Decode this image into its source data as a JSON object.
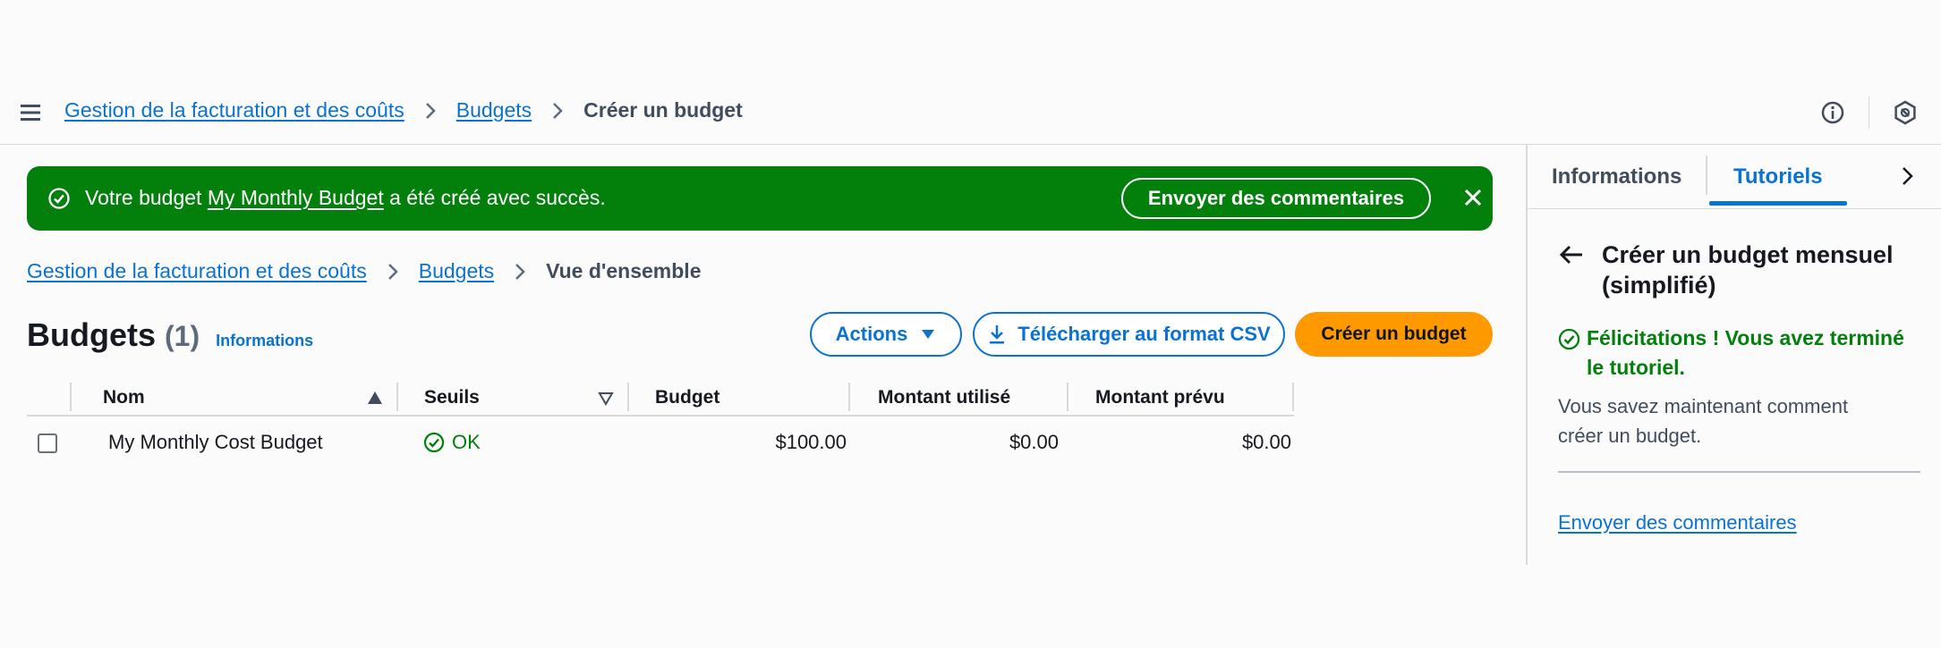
{
  "topbar": {
    "breadcrumb": {
      "root": "Gestion de la facturation et des coûts",
      "budgets": "Budgets",
      "current": "Créer un budget"
    },
    "icons": [
      "menu-icon",
      "info-icon",
      "notifications-icon"
    ]
  },
  "flash": {
    "prefix": "Votre budget ",
    "budget_name": "My Monthly Budget",
    "suffix": " a été créé avec succès.",
    "feedback_button": "Envoyer des commentaires",
    "color": "#037f0c"
  },
  "page": {
    "breadcrumb": {
      "root": "Gestion de la facturation et des coûts",
      "budgets": "Budgets",
      "current": "Vue d'ensemble"
    },
    "title": "Budgets",
    "count": "(1)",
    "info_link": "Informations",
    "actions_button": "Actions",
    "csv_button": "Télécharger au format CSV",
    "create_button": "Créer un budget",
    "accent_color": "#0972d3",
    "primary_color": "#ff9900"
  },
  "table": {
    "columns": [
      "Nom",
      "Seuils",
      "Budget",
      "Montant utilisé",
      "Montant prévu"
    ],
    "rows": [
      {
        "name": "My Monthly Cost Budget",
        "threshold": "OK",
        "budget": "$100.00",
        "used": "$0.00",
        "forecast": "$0.00"
      }
    ]
  },
  "side_panel": {
    "tabs": [
      "Informations",
      "Tutoriels"
    ],
    "active_tab": "Tutoriels",
    "title": "Créer un budget mensuel (simplifié)",
    "success": "Félicitations ! Vous avez terminé le tutoriel.",
    "text": "Vous savez maintenant comment créer un budget.",
    "feedback_link": "Envoyer des commentaires"
  }
}
